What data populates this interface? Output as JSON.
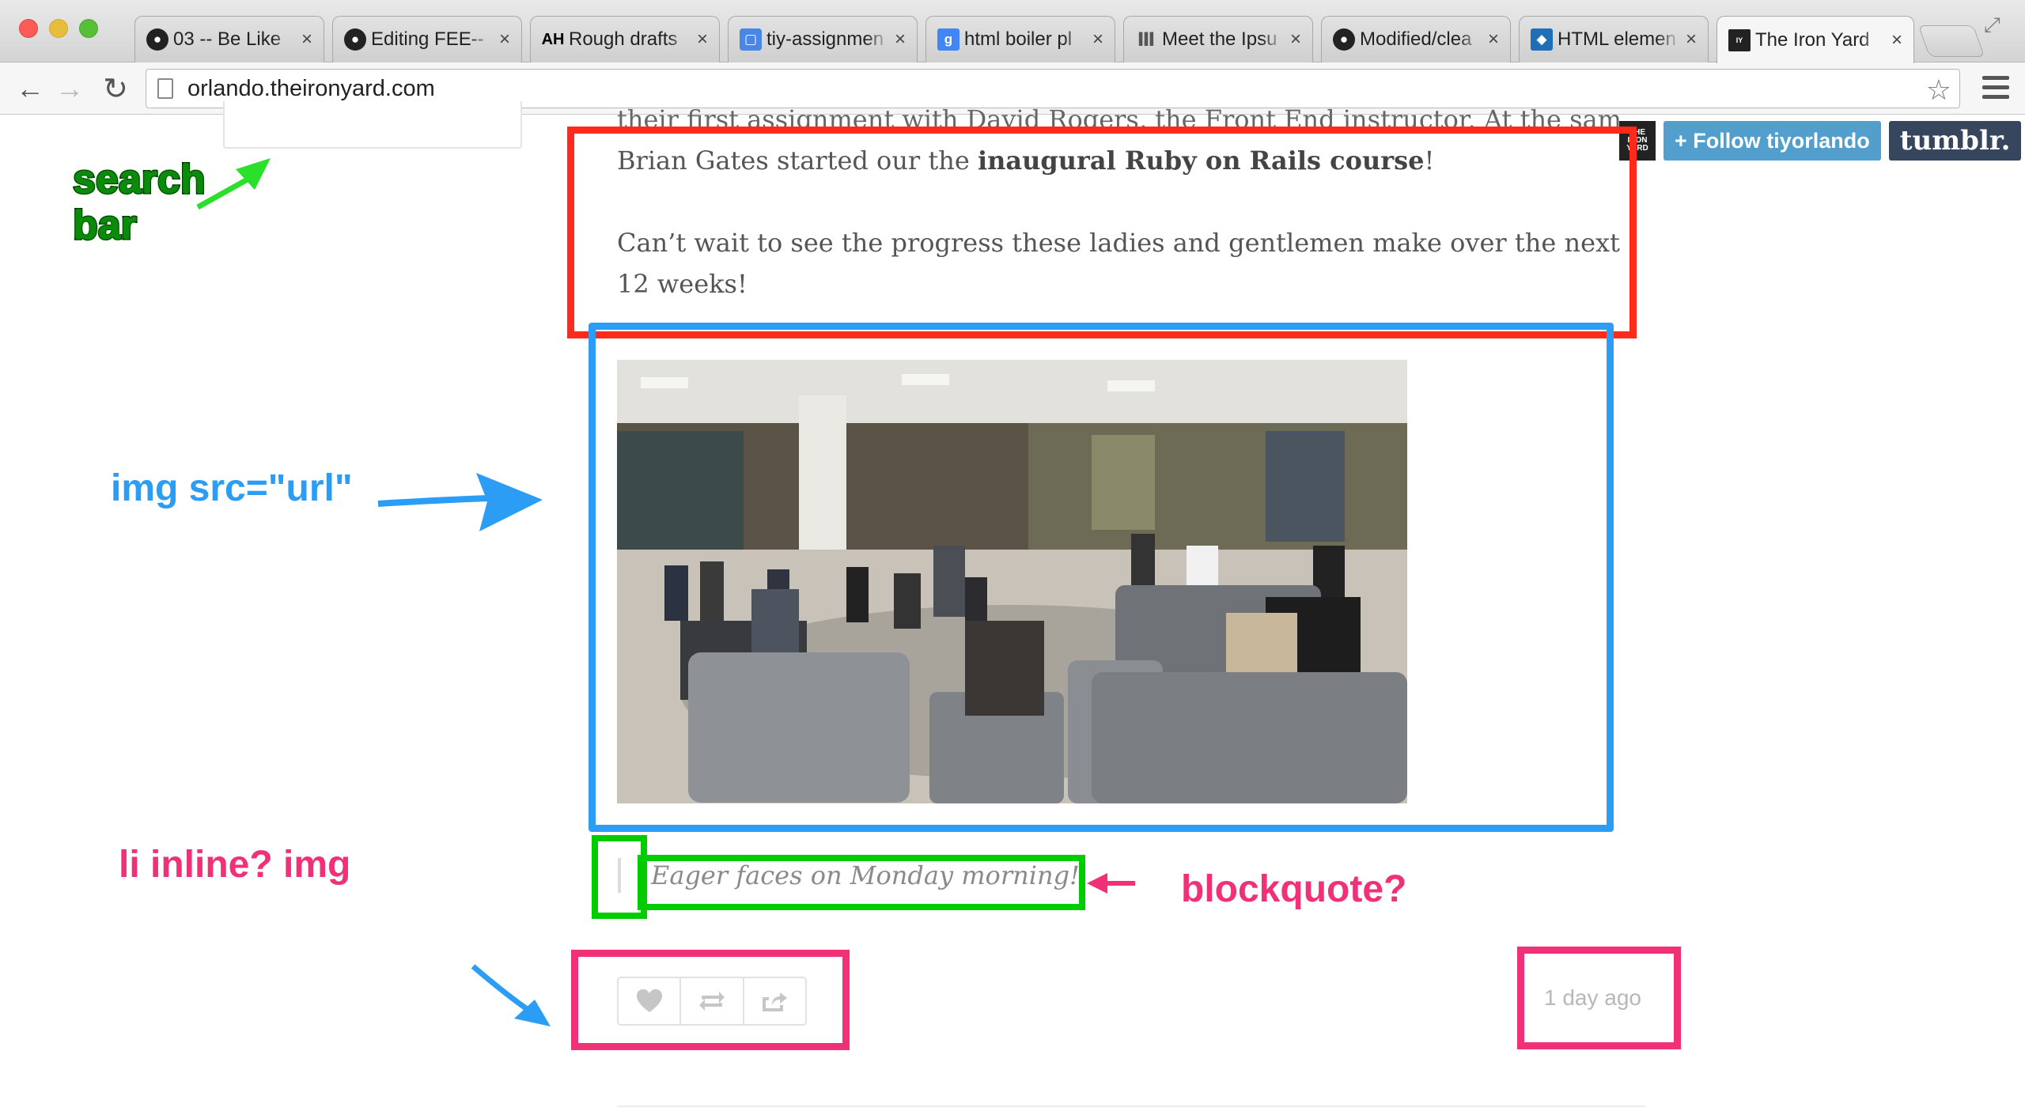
{
  "browser": {
    "tabs": [
      {
        "label": "03 -- Be Like",
        "icon": "github-icon"
      },
      {
        "label": "Editing FEE--",
        "icon": "github-icon"
      },
      {
        "label": "Rough drafts",
        "icon": "ah-icon",
        "icon_text": "AH"
      },
      {
        "label": "tiy-assignmen",
        "icon": "doc-icon"
      },
      {
        "label": "html boiler pl",
        "icon": "google-icon",
        "icon_text": "g"
      },
      {
        "label": "Meet the Ipsu",
        "icon": "column-icon"
      },
      {
        "label": "Modified/clea",
        "icon": "github-icon"
      },
      {
        "label": "HTML elemen",
        "icon": "codepen-icon"
      },
      {
        "label": "The Iron Yard",
        "icon": "ironyard-icon",
        "active": true
      }
    ],
    "close_glyph": "×",
    "url": "orlando.theironyard.com"
  },
  "page": {
    "post": {
      "line_cut": "their first assignment with David Rogers, the Front End instructor. At the same time",
      "line2_pre": "Brian Gates started our the ",
      "line2_bold": "inaugural Ruby on Rails course",
      "line2_post": "!",
      "para2": "Can’t wait to see the progress these ladies and gentlemen make over the next 12 weeks!"
    },
    "tumblr": {
      "logo_text": "THE IRON YARD",
      "follow_label": "+ Follow tiyorlando",
      "brand_label": "tumblr."
    },
    "caption": "Eager faces on Monday morning!",
    "actions": [
      "heart-icon",
      "reblog-icon",
      "share-icon"
    ],
    "timestamp": "1 day ago"
  },
  "annotations": {
    "search_bar": "search\nbar",
    "img": "img src=\"url\"",
    "li": "li inline? img",
    "blockquote": "blockquote?",
    "colors": {
      "green": "#0c0",
      "blue": "#2b9df4",
      "red": "#ff2a1a",
      "pink": "#f03178"
    }
  }
}
